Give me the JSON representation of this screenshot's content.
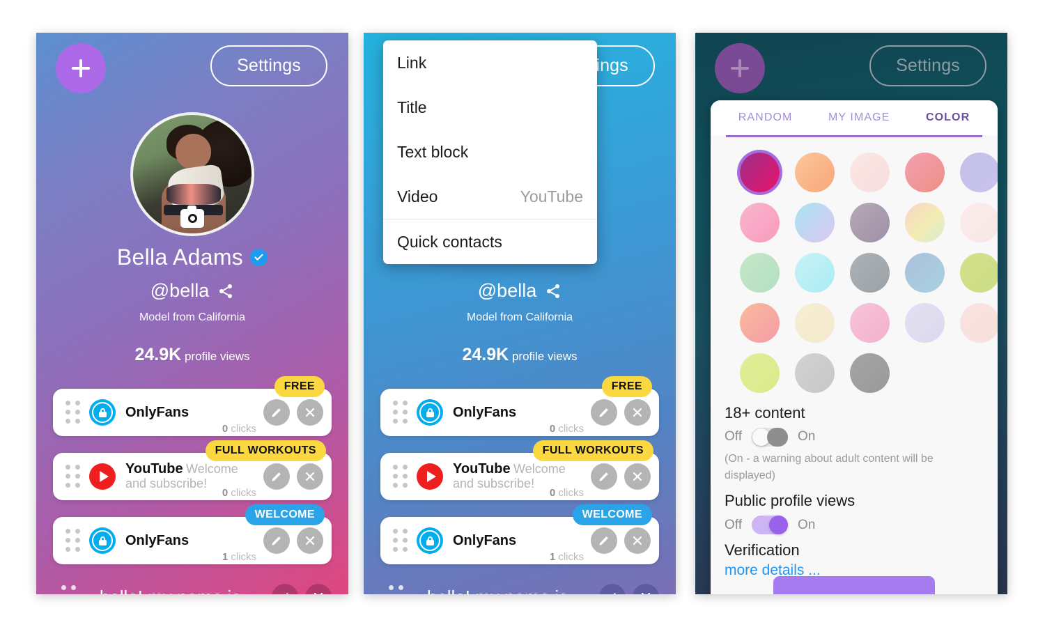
{
  "panels": {
    "p1": {
      "add_button": "+",
      "settings_button": "Settings",
      "profile": {
        "name": "Bella Adams",
        "handle": "@bella",
        "bio": "Model from California",
        "views_count": "24.9K",
        "views_label": "profile views",
        "verified": true
      },
      "cards": [
        {
          "title": "OnlyFans",
          "subtitle": "",
          "clicks_num": "0",
          "clicks_label": "clicks",
          "badge": "FREE",
          "badge_style": "yellow",
          "icon": "onlyfans-icon"
        },
        {
          "title": "YouTube",
          "subtitle": "Welcome and subscribe!",
          "clicks_num": "0",
          "clicks_label": "clicks",
          "badge": "FULL WORKOUTS",
          "badge_style": "yellow",
          "icon": "youtube-icon"
        },
        {
          "title": "OnlyFans",
          "subtitle": "",
          "clicks_num": "1",
          "clicks_label": "clicks",
          "badge": "WELCOME",
          "badge_style": "blue",
          "icon": "onlyfans-icon"
        }
      ],
      "text_block": "hello! my name is"
    },
    "p2": {
      "add_button": "+",
      "settings_button": "ttings",
      "menu": {
        "items": [
          {
            "label": "Link",
            "hint": ""
          },
          {
            "label": "Title",
            "hint": ""
          },
          {
            "label": "Text block",
            "hint": ""
          },
          {
            "label": "Video",
            "hint": "YouTube"
          }
        ],
        "footer_item": {
          "label": "Quick contacts",
          "hint": ""
        }
      },
      "profile": {
        "handle": "@bella",
        "bio": "Model from California",
        "views_count": "24.9K",
        "views_label": "profile views"
      },
      "cards": [
        {
          "title": "OnlyFans",
          "subtitle": "",
          "clicks_num": "0",
          "clicks_label": "clicks",
          "badge": "FREE",
          "badge_style": "yellow",
          "icon": "onlyfans-icon"
        },
        {
          "title": "YouTube",
          "subtitle": "Welcome and subscribe!",
          "clicks_num": "0",
          "clicks_label": "clicks",
          "badge": "FULL WORKOUTS",
          "badge_style": "yellow",
          "icon": "youtube-icon"
        },
        {
          "title": "OnlyFans",
          "subtitle": "",
          "clicks_num": "1",
          "clicks_label": "clicks",
          "badge": "WELCOME",
          "badge_style": "blue",
          "icon": "onlyfans-icon"
        }
      ],
      "text_block": "hello! my name is"
    },
    "p3": {
      "add_button": "+",
      "settings_button": "Settings",
      "modal": {
        "tabs": [
          {
            "label": "RANDOM",
            "active": false
          },
          {
            "label": "MY IMAGE",
            "active": false
          },
          {
            "label": "COLOR",
            "active": true
          }
        ],
        "swatches": [
          {
            "css": "linear-gradient(135deg,#9c2f8a 0%, #e8136a 100%)",
            "selected": true
          },
          {
            "css": "linear-gradient(135deg,#fcc79a 0%, #f8a679 100%)",
            "selected": false
          },
          {
            "css": "linear-gradient(135deg,#fbe7e4 0%, #f6dedd 100%)",
            "selected": false
          },
          {
            "css": "linear-gradient(135deg,#f2a0b4 0%, #ef8f82 100%)",
            "selected": false
          },
          {
            "css": "linear-gradient(135deg,#c3c0ea 0%, #c9c3ee 100%)",
            "selected": false
          },
          {
            "css": "linear-gradient(135deg,#f9b6cd 0%, #f79bbd 100%)",
            "selected": false
          },
          {
            "css": "linear-gradient(135deg,#a9e4f2 0%, #dcc6f0 100%)",
            "selected": false
          },
          {
            "css": "linear-gradient(135deg,#b7a7b8 0%, #9f90a6 100%)",
            "selected": false
          },
          {
            "css": "linear-gradient(135deg,#f8d3c0 0%, #f3edb6 55%, #d8ead2 100%)",
            "selected": false
          },
          {
            "css": "linear-gradient(135deg,#fbeceb 0%, #f8e6e6 100%)",
            "selected": false
          },
          {
            "css": "linear-gradient(135deg,#c5e7c6 0%, #b4dfc4 100%)",
            "selected": false
          },
          {
            "css": "linear-gradient(135deg,#c8f2f6 0%, #a9ecf4 100%)",
            "selected": false
          },
          {
            "css": "linear-gradient(135deg,#adb2b6 0%, #9ba1a6 100%)",
            "selected": false
          },
          {
            "css": "linear-gradient(135deg,#adbfdc 0%, #a6d3e0 100%)",
            "selected": false
          },
          {
            "css": "linear-gradient(135deg,#d3e089 0%, #cbdd85 100%)",
            "selected": false
          },
          {
            "css": "linear-gradient(135deg,#f9bb9b 0%, #f49ba8 100%)",
            "selected": false
          },
          {
            "css": "linear-gradient(135deg,#f6edd3 0%, #f3e9cc 100%)",
            "selected": false
          },
          {
            "css": "linear-gradient(135deg,#f7c4d8 0%, #f4b0cd 100%)",
            "selected": false
          },
          {
            "css": "linear-gradient(135deg,#e2dff0 0%, #dcd9ee 100%)",
            "selected": false
          },
          {
            "css": "linear-gradient(135deg,#fae4e0 0%, #f8dfdb 100%)",
            "selected": false
          },
          {
            "css": "linear-gradient(135deg,#e2ee96 0%, #dbe98c 100%)",
            "selected": false
          },
          {
            "css": "linear-gradient(135deg,#d2d2d2 0%, #c7c7c7 100%)",
            "selected": false
          },
          {
            "css": "linear-gradient(135deg,#a5a5a5 0%, #999999 100%)",
            "selected": false
          }
        ],
        "settings": [
          {
            "title": "18+ content",
            "off_label": "Off",
            "on_label": "On",
            "state": "off",
            "note": "(On - a warning about adult content will be displayed)"
          },
          {
            "title": "Public profile views",
            "off_label": "Off",
            "on_label": "On",
            "state": "on",
            "note": ""
          }
        ],
        "verification_title": "Verification",
        "more_details": "more details ..."
      }
    }
  },
  "colors": {
    "accent_purple": "#a77bf0",
    "badge_yellow": "#fbd83f",
    "badge_blue": "#2aa3e8",
    "onlyfans_blue": "#00aeef",
    "youtube_red": "#ef1f1f",
    "verified_blue": "#1d9bf0",
    "link_blue": "#2196f3",
    "tab_active": "#6a4fa3"
  }
}
